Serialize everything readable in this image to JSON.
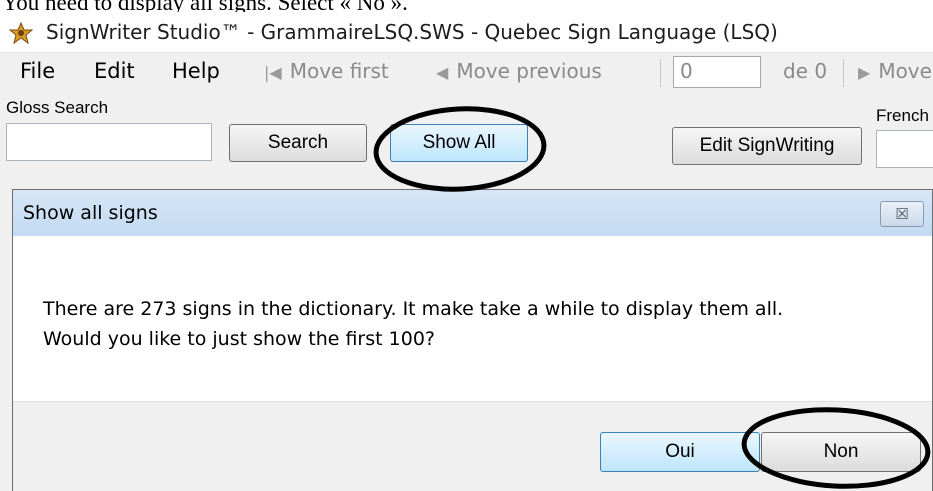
{
  "doc_text": "You need to display all signs.  Select « No ».",
  "window": {
    "title": "SignWriter Studio™ - GrammaireLSQ.SWS - Quebec Sign Language (LSQ)"
  },
  "menu": {
    "file": "File",
    "edit": "Edit",
    "help": "Help"
  },
  "navigator": {
    "move_first": "Move first",
    "move_previous": "Move previous",
    "position": "0",
    "count": "de 0",
    "move_next": "Move n"
  },
  "search": {
    "gloss_label": "Gloss Search",
    "gloss_value": "",
    "search_button": "Search",
    "show_all_button": "Show All",
    "edit_signwriting_button": "Edit SignWriting",
    "french_label": "French"
  },
  "dialog": {
    "title": "Show all signs",
    "close_glyph": "☒",
    "message_line1": "There are 273 signs in the dictionary.  It make take a while to display them all.",
    "message_line2": "Would you like to just show the first 100?",
    "yes_button": "Oui",
    "no_button": "Non"
  },
  "icons": {
    "app": "signwriter-app-icon",
    "first": "first-record-icon",
    "previous": "previous-record-icon",
    "next": "next-record-icon",
    "close": "close-icon"
  },
  "colors": {
    "dialog_title_bg": "#c3daf1",
    "focus_button_bg": "#bee6fd",
    "annotation": "#000000"
  }
}
